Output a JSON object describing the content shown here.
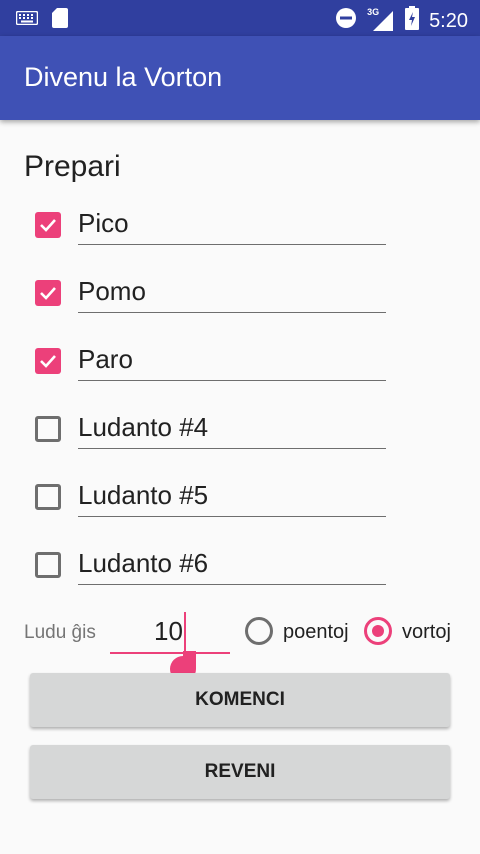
{
  "statusbar": {
    "network": "3G",
    "time": "5:20",
    "icons": [
      "keyboard-icon",
      "sd-card-icon",
      "do-not-disturb-icon",
      "signal-icon",
      "battery-icon"
    ]
  },
  "appbar": {
    "title": "Divenu la Vorton"
  },
  "players_section": {
    "title": "Prepari",
    "players": [
      {
        "name": "Pico",
        "checked": true
      },
      {
        "name": "Pomo",
        "checked": true
      },
      {
        "name": "Paro",
        "checked": true
      },
      {
        "name": "Ludanto #4",
        "checked": false
      },
      {
        "name": "Ludanto #5",
        "checked": false
      },
      {
        "name": "Ludanto #6",
        "checked": false
      }
    ]
  },
  "play_until": {
    "label": "Ludu ĝis",
    "value": "10",
    "options": [
      {
        "label": "poentoj",
        "selected": false
      },
      {
        "label": "vortoj",
        "selected": true
      }
    ]
  },
  "buttons": {
    "start": "KOMENCI",
    "back": "REVENI"
  },
  "colors": {
    "status_bar": "#303f9f",
    "app_bar": "#3f51b5",
    "accent": "#ec407a",
    "button_bg": "#d6d7d7"
  }
}
